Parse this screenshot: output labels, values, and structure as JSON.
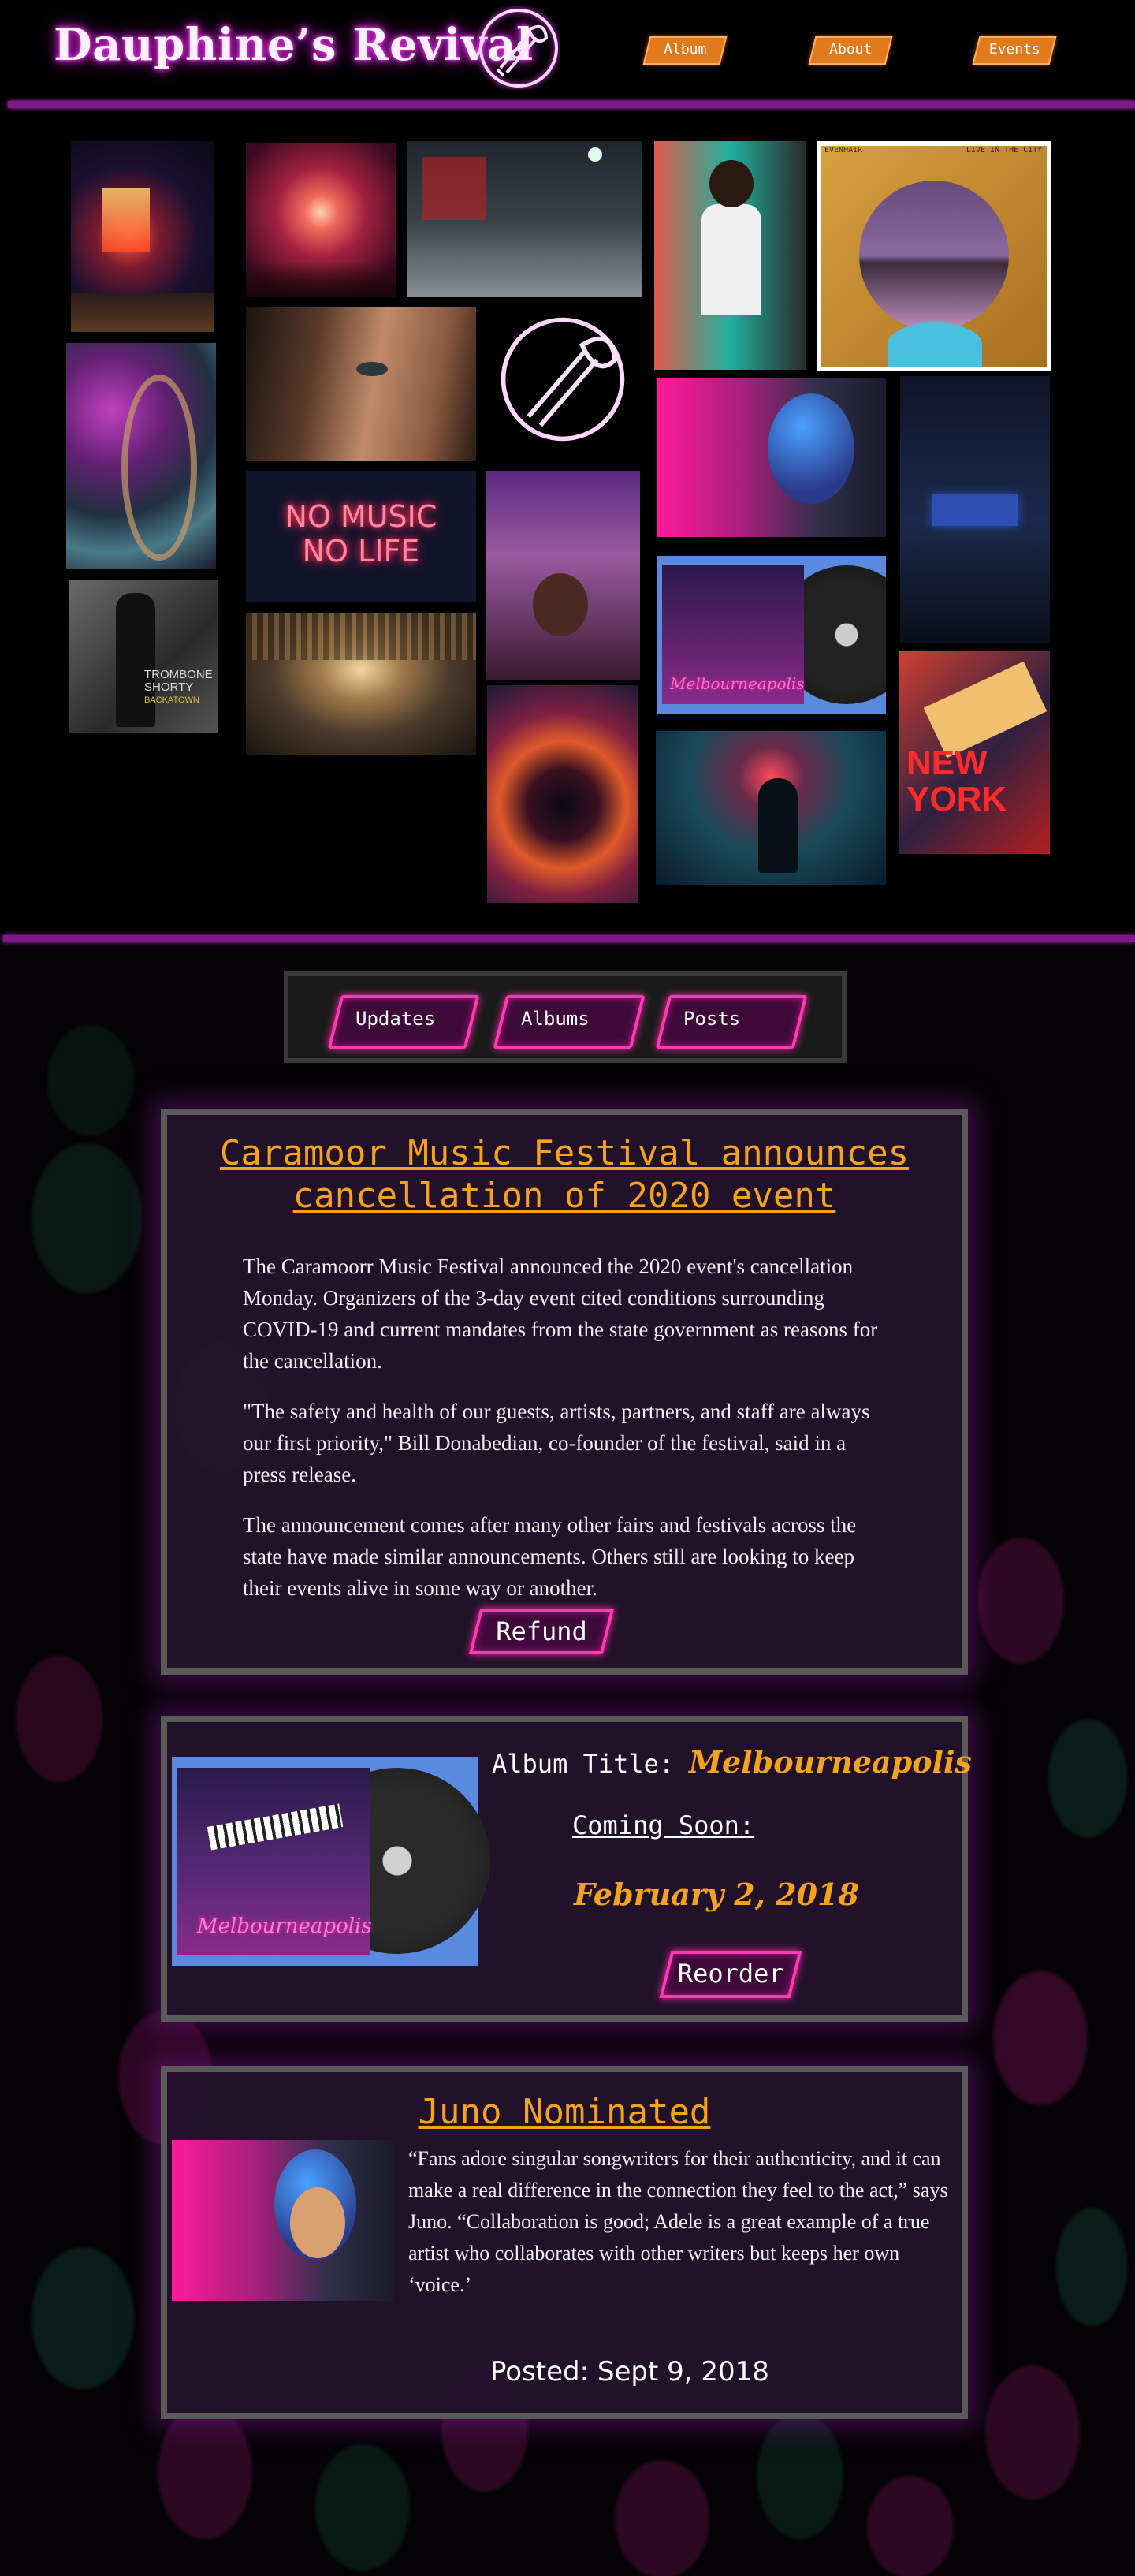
{
  "site": {
    "title": "Dauphine’s Revival"
  },
  "nav": {
    "items": [
      {
        "label": "Album"
      },
      {
        "label": "About"
      },
      {
        "label": "Events"
      }
    ]
  },
  "gallery": {
    "tiles": [
      {
        "name": "theater-marquee-photo",
        "caption": ""
      },
      {
        "name": "concert-crowd-photo",
        "caption": ""
      },
      {
        "name": "snowy-city-street-photo",
        "caption": ""
      },
      {
        "name": "man-in-white-tshirt-photo",
        "caption": ""
      },
      {
        "name": "live-in-the-city-album-art",
        "caption_left": "EVENHAIR",
        "caption_right": "LIVE IN THE CITY"
      },
      {
        "name": "purple-fluid-art-photo",
        "caption": ""
      },
      {
        "name": "woman-face-closeup-photo",
        "caption": ""
      },
      {
        "name": "neon-trumpet-logo-tile",
        "caption": ""
      },
      {
        "name": "woman-blue-hair-photo",
        "caption": ""
      },
      {
        "name": "night-diner-photo",
        "caption": ""
      },
      {
        "name": "no-music-no-life-neon-sign",
        "line1": "NO MUSIC",
        "line2": "NO LIFE"
      },
      {
        "name": "singer-looking-up-photo",
        "caption": ""
      },
      {
        "name": "melbourneapolis-album-tile",
        "caption": "Melbourneapolis"
      },
      {
        "name": "trombone-shorty-album-art",
        "line1": "TROMBONE",
        "line2": "SHORTY",
        "line3": "BACKATOWN"
      },
      {
        "name": "museum-hall-photo",
        "caption": ""
      },
      {
        "name": "city-lights-blur-photo",
        "caption": ""
      },
      {
        "name": "hooded-figure-photo",
        "caption": ""
      },
      {
        "name": "new-york-poster-photo",
        "line1": "NEW",
        "line2": "YORK"
      }
    ]
  },
  "tabs": [
    {
      "label": "Updates"
    },
    {
      "label": "Albums"
    },
    {
      "label": "Posts"
    }
  ],
  "news": {
    "title": "Caramoor Music Festival announces cancellation of 2020 event",
    "paragraphs": [
      "The Caramoorr Music Festival announced the 2020 event's cancellation Monday. Organizers of the 3-day event cited conditions surrounding COVID-19 and current mandates from the state government as reasons for the cancellation.",
      "\"The safety and health of our guests, artists, partners, and staff are always our first priority,\" Bill Donabedian, co-founder of the festival, said in a press release.",
      "The announcement comes after many other fairs and festivals across the state have made similar announcements. Others still are looking to keep their events alive in some way or another."
    ],
    "button": "Refund"
  },
  "album": {
    "title_label": "Album Title:",
    "title_value": "Melbourneapolis",
    "coming_label": "Coming Soon:",
    "date": "February 2, 2018",
    "button": "Reorder",
    "cover_text": "Melbourneapolis"
  },
  "post": {
    "title": "Juno Nominated",
    "body": "“Fans adore singular songwriters for their authenticity, and it can make a real difference in the connection they feel to the act,” says Juno. “Collaboration is good; Adele is a great example of a true artist who collaborates with other writers but keeps her own ‘voice.’",
    "posted_label": "Posted:",
    "posted_date": "Sept 9, 2018"
  },
  "colors": {
    "accent": "#f5a21e",
    "neon_pink": "#ff3ab4",
    "rule_purple": "#7c1a8a",
    "nav_orange": "#e07a1c"
  },
  "icons": {
    "logo": "neon-trumpet-icon"
  }
}
